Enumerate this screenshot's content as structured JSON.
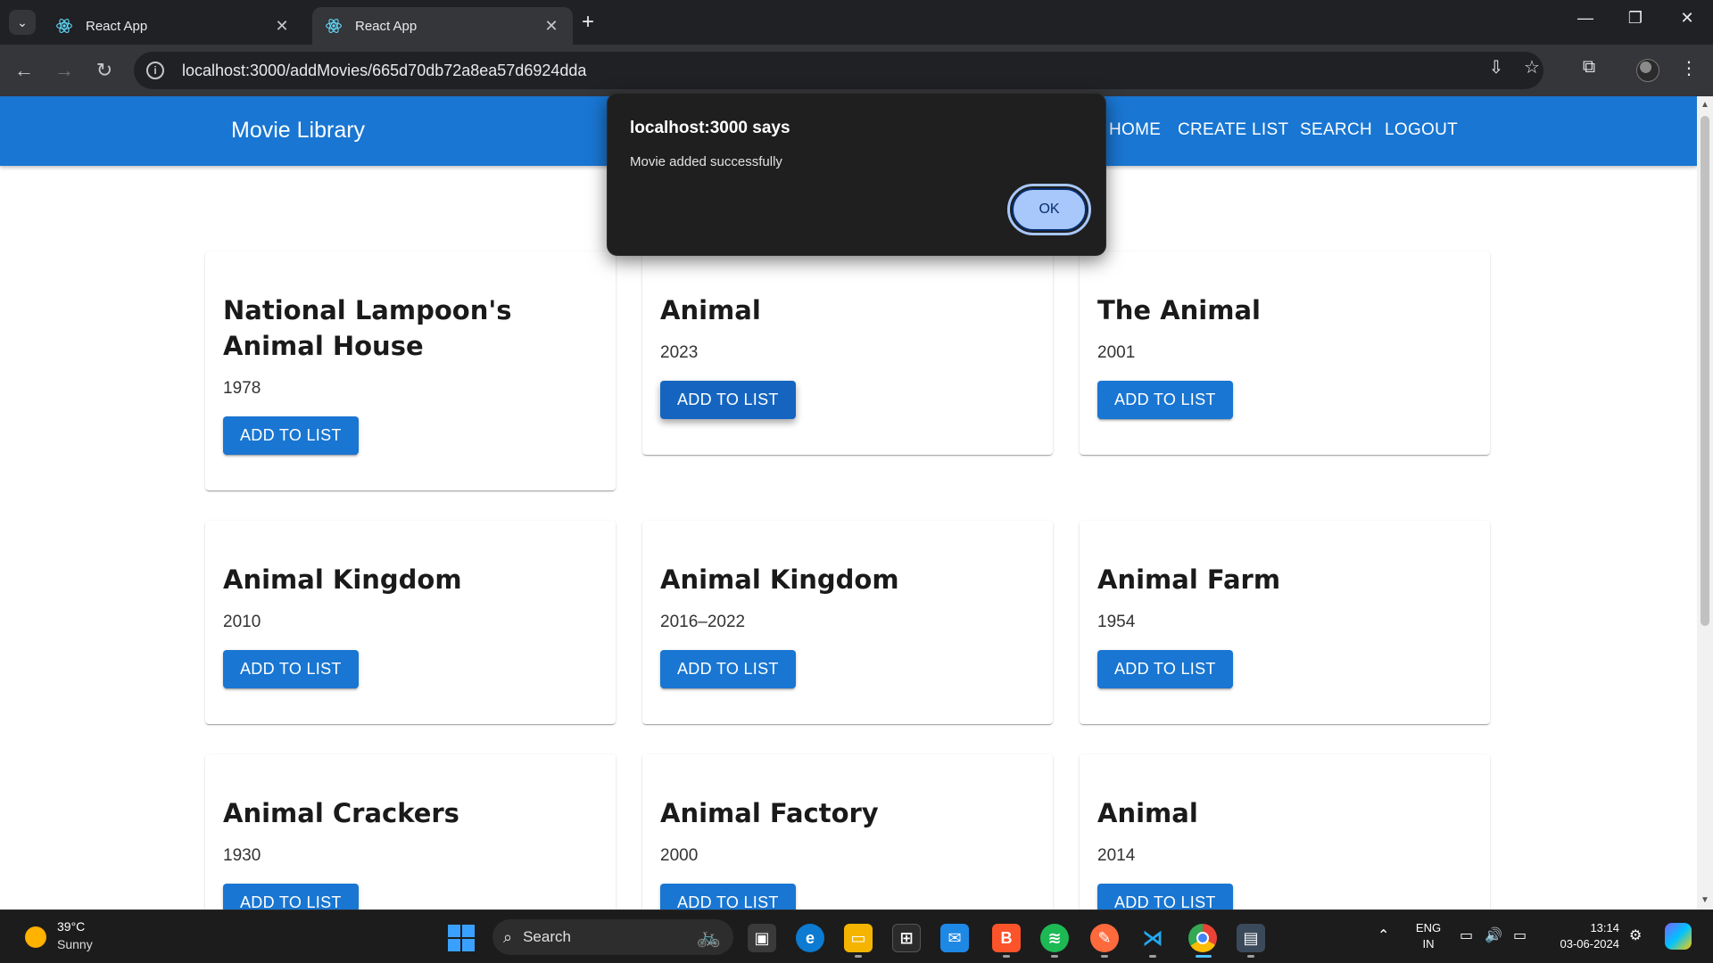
{
  "browser": {
    "tabs": [
      {
        "title": "React App",
        "active": false
      },
      {
        "title": "React App",
        "active": true
      }
    ],
    "url": "localhost:3000/addMovies/665d70db72a8ea57d6924dda"
  },
  "app": {
    "brand": "Movie Library",
    "nav": [
      "HOME",
      "CREATE LIST",
      "SEARCH",
      "LOGOUT"
    ],
    "brand_color": "#1976d2"
  },
  "movies": [
    {
      "title": "National Lampoon's Animal House",
      "year": "1978",
      "button": "ADD TO LIST"
    },
    {
      "title": "Animal",
      "year": "2023",
      "button": "ADD TO LIST"
    },
    {
      "title": "The Animal",
      "year": "2001",
      "button": "ADD TO LIST"
    },
    {
      "title": "Animal Kingdom",
      "year": "2010",
      "button": "ADD TO LIST"
    },
    {
      "title": "Animal Kingdom",
      "year": "2016–2022",
      "button": "ADD TO LIST"
    },
    {
      "title": "Animal Farm",
      "year": "1954",
      "button": "ADD TO LIST"
    },
    {
      "title": "Animal Crackers",
      "year": "1930",
      "button": "ADD TO LIST"
    },
    {
      "title": "Animal Factory",
      "year": "2000",
      "button": "ADD TO LIST"
    },
    {
      "title": "Animal",
      "year": "2014",
      "button": "ADD TO LIST"
    }
  ],
  "dialog": {
    "title": "localhost:3000 says",
    "message": "Movie added successfully",
    "ok": "OK"
  },
  "taskbar": {
    "temperature": "39°C",
    "condition": "Sunny",
    "search_placeholder": "Search",
    "language_1": "ENG",
    "language_2": "IN",
    "time": "13:14",
    "date": "03-06-2024"
  }
}
